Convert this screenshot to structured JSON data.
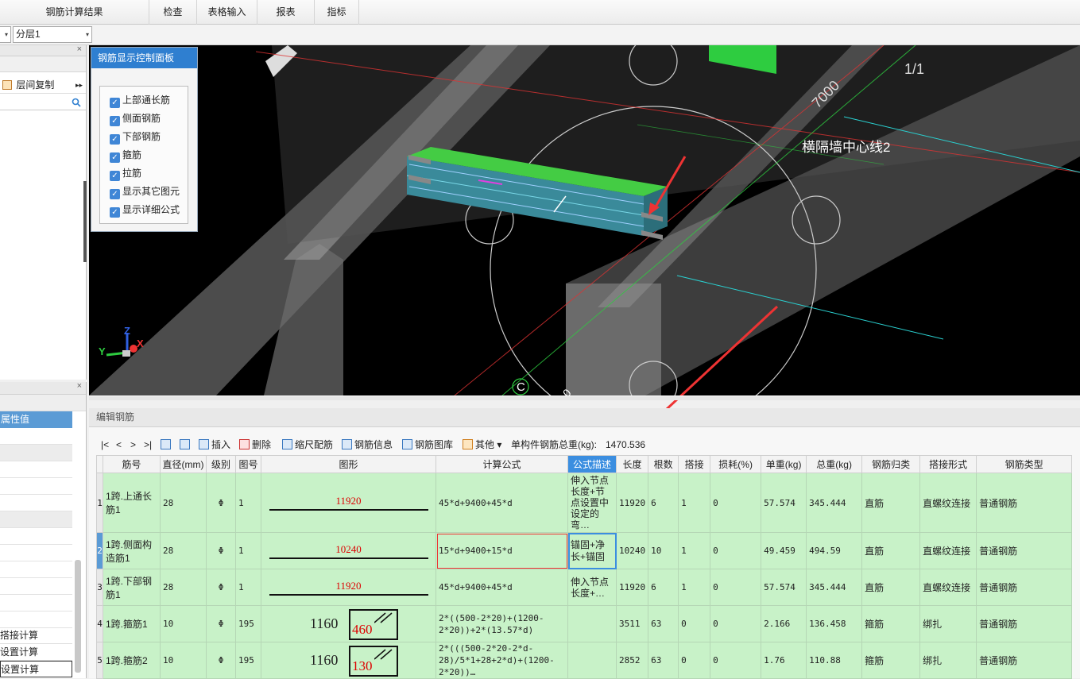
{
  "menubar": {
    "items": [
      "钢筋计算结果",
      "检查",
      "表格输入",
      "报表",
      "指标"
    ]
  },
  "toolbar2": {
    "left_combo_arrow": "▾",
    "floor_combo": "分层1"
  },
  "left_top": {
    "copy_label": "层间复制",
    "close": "×"
  },
  "left_bottom": {
    "close": "×",
    "header": "属性值",
    "items": [
      "搭接计算",
      "设置计算",
      "设置计算"
    ]
  },
  "viewport": {
    "labels": {
      "dim": "7000",
      "axis_1": "1/1",
      "centerline": "横隔墙中心线2",
      "axis_c": "C",
      "axis_0": "0",
      "coord_z": "Z",
      "coord_y": "Y",
      "coord_x": "X"
    }
  },
  "control_panel": {
    "title": "钢筋显示控制面板",
    "items": [
      "上部通长筋",
      "侧面钢筋",
      "下部钢筋",
      "箍筋",
      "拉筋",
      "显示其它图元",
      "显示详细公式"
    ]
  },
  "editor": {
    "header": "编辑钢筋",
    "nav": [
      "|<",
      "<",
      ">",
      ">|"
    ],
    "buttons": [
      "插入",
      "删除",
      "缩尺配筋",
      "钢筋信息",
      "钢筋图库",
      "其他"
    ],
    "total_weight_label": "单构件钢筋总重(kg):",
    "total_weight": "1470.536",
    "columns": [
      "筋号",
      "直径(mm)",
      "级别",
      "图号",
      "图形",
      "计算公式",
      "公式描述",
      "长度",
      "根数",
      "搭接",
      "损耗(%)",
      "单重(kg)",
      "总重(kg)",
      "钢筋归类",
      "搭接形式",
      "钢筋类型"
    ],
    "rows": [
      {
        "no": "1",
        "name": "1跨.上通长筋1",
        "dia": "28",
        "grade": "Φ",
        "fig": "1",
        "shape": "11920",
        "formula": "45*d+9400+45*d",
        "desc": "伸入节点长度+节点设置中设定的弯…",
        "len": "11920",
        "count": "6",
        "lap": "1",
        "loss": "0",
        "unit": "57.574",
        "total": "345.444",
        "cat": "直筋",
        "lap_type": "直螺纹连接",
        "type": "普通钢筋"
      },
      {
        "no": "2",
        "name": "1跨.侧面构造筋1",
        "dia": "28",
        "grade": "Φ",
        "fig": "1",
        "shape": "10240",
        "formula": "15*d+9400+15*d",
        "desc": "锚固+净长+锚固",
        "len": "10240",
        "count": "10",
        "lap": "1",
        "loss": "0",
        "unit": "49.459",
        "total": "494.59",
        "cat": "直筋",
        "lap_type": "直螺纹连接",
        "type": "普通钢筋"
      },
      {
        "no": "3",
        "name": "1跨.下部钢筋1",
        "dia": "28",
        "grade": "Φ",
        "fig": "1",
        "shape": "11920",
        "formula": "45*d+9400+45*d",
        "desc": "伸入节点长度+…",
        "len": "11920",
        "count": "6",
        "lap": "1",
        "loss": "0",
        "unit": "57.574",
        "total": "345.444",
        "cat": "直筋",
        "lap_type": "直螺纹连接",
        "type": "普通钢筋"
      },
      {
        "no": "4",
        "name": "1跨.箍筋1",
        "dia": "10",
        "grade": "Φ",
        "fig": "195",
        "shape_a": "1160",
        "shape_b": "460",
        "formula": "2*((500-2*20)+(1200-2*20))+2*(13.57*d)",
        "desc": "",
        "len": "3511",
        "count": "63",
        "lap": "0",
        "loss": "0",
        "unit": "2.166",
        "total": "136.458",
        "cat": "箍筋",
        "lap_type": "绑扎",
        "type": "普通钢筋"
      },
      {
        "no": "5",
        "name": "1跨.箍筋2",
        "dia": "10",
        "grade": "Φ",
        "fig": "195",
        "shape_a": "1160",
        "shape_b": "130",
        "formula": "2*(((500-2*20-2*d-28)/5*1+28+2*d)+(1200-2*20))…",
        "desc": "",
        "len": "2852",
        "count": "63",
        "lap": "0",
        "loss": "0",
        "unit": "1.76",
        "total": "110.88",
        "cat": "箍筋",
        "lap_type": "绑扎",
        "type": "普通钢筋"
      }
    ]
  }
}
